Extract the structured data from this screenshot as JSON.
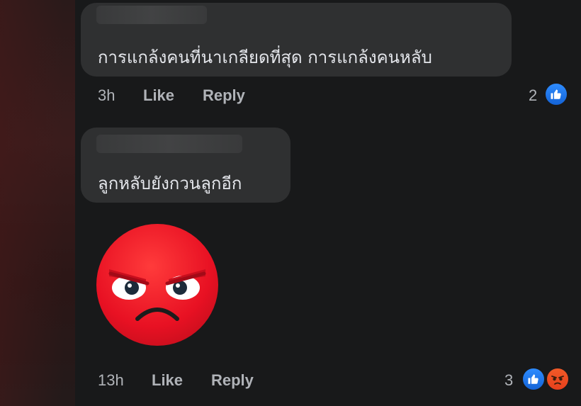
{
  "comments": [
    {
      "text": "การแกล้งคนที่นาเกลียดที่สุด การแกล้งคนหลับ",
      "time": "3h",
      "like_label": "Like",
      "reply_label": "Reply",
      "reaction_count": "2",
      "reactions": [
        "like-icon"
      ]
    },
    {
      "text": "ลูกหลับยังกวนลูกอีก",
      "time": "13h",
      "like_label": "Like",
      "reply_label": "Reply",
      "reaction_count": "3",
      "reactions": [
        "like-icon",
        "angry-icon"
      ],
      "sticker": "angry-face-sticker"
    }
  ],
  "colors": {
    "background": "#18191a",
    "bubble": "#2f3031",
    "text": "#e4e6eb",
    "meta": "#b0b3b8",
    "like_blue": "#1877f2",
    "angry_red": "#e8401c"
  }
}
